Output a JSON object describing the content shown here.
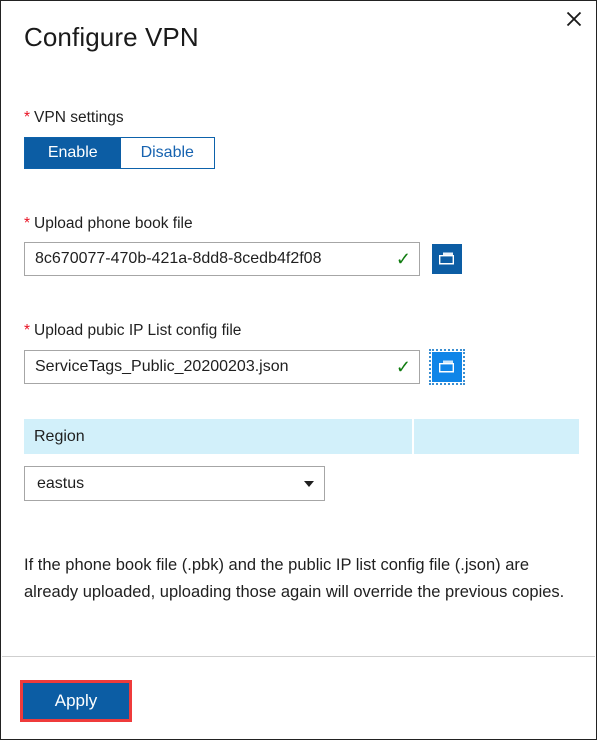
{
  "panel": {
    "title": "Configure VPN",
    "close_label": "Close",
    "close_icon": "close-icon"
  },
  "vpn_settings": {
    "label": "VPN settings",
    "required_marker": "*",
    "options": [
      "Enable",
      "Disable"
    ],
    "selected": "Enable",
    "enable_label": "Enable",
    "disable_label": "Disable"
  },
  "phone_book": {
    "label": "Upload phone book file",
    "required_marker": "*",
    "value": "8c670077-470b-421a-8dd8-8cedb4f2f08",
    "placeholder": "",
    "validated_icon": "✓",
    "browse_icon": "folder-icon",
    "browse_label": "Browse"
  },
  "public_ip": {
    "label": "Upload pubic IP List config file",
    "required_marker": "*",
    "value": "ServiceTags_Public_20200203.json",
    "placeholder": "",
    "validated_icon": "✓",
    "browse_icon": "folder-icon",
    "browse_label": "Browse"
  },
  "region_table": {
    "columns": [
      "Region",
      ""
    ],
    "column_1": "Region",
    "column_2": ""
  },
  "region_select": {
    "value": "eastus",
    "caret_icon": "chevron-down-icon"
  },
  "description": {
    "text": "If the phone book file (.pbk) and the public IP list config file (.json) are already uploaded, uploading those again will override the previous copies."
  },
  "footer": {
    "apply_label": "Apply"
  },
  "colors": {
    "primary_blue": "#0c5da4",
    "accent_blue": "#0f85e8",
    "link_blue": "#1763b0",
    "required_red": "#e81123",
    "highlight_red": "#ef3b3b",
    "check_green": "#107c10",
    "table_header_cyan": "#d2f0fa"
  }
}
